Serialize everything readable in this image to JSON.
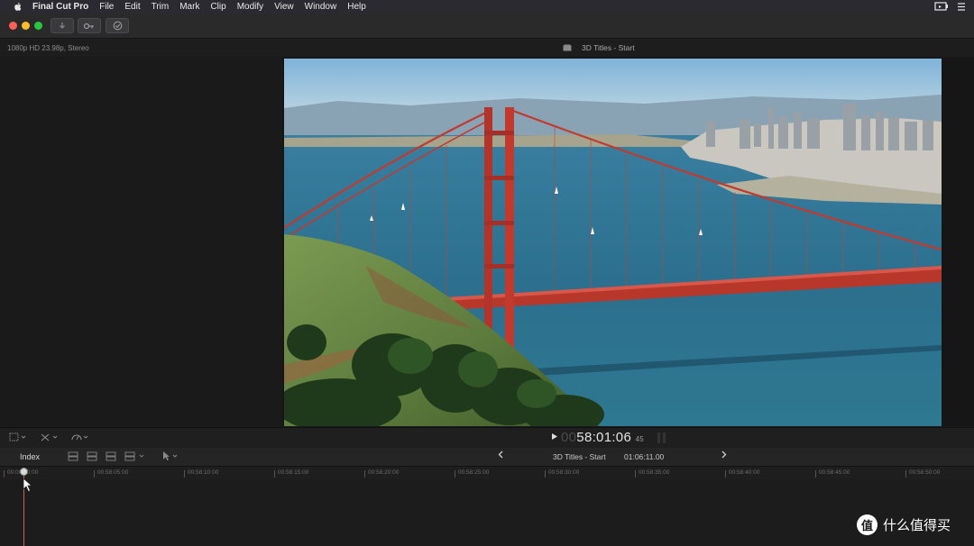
{
  "menubar": {
    "app_name": "Final Cut Pro",
    "items": [
      "File",
      "Edit",
      "Trim",
      "Mark",
      "Clip",
      "Modify",
      "View",
      "Window",
      "Help"
    ]
  },
  "toolbar": {
    "buttons": [
      "import-icon",
      "keyword-icon",
      "background-tasks-icon"
    ]
  },
  "viewer": {
    "format": "1080p HD 23.98p, Stereo",
    "project_title": "3D Titles - Start"
  },
  "transport": {
    "timecode_dim": "00",
    "timecode": "58:01:06",
    "timecode_frames": "45"
  },
  "timeline": {
    "index_label": "Index",
    "project_name": "3D Titles - Start",
    "duration": "01:06:11.00",
    "ruler": [
      "00:00:00:00",
      "00:58:05:00",
      "00:58:10:00",
      "00:58:15:00",
      "00:58:20:00",
      "00:58:25:00",
      "00:58:30:00",
      "00:58:35:00",
      "00:58:40:00",
      "00:58:45:00",
      "00:58:50:00"
    ]
  },
  "watermark": {
    "logo_char": "值",
    "text": "什么值得买"
  },
  "colors": {
    "accent_playhead": "#c46a4e",
    "bridge_red": "#c23a2e",
    "water": "#2b6f8e"
  }
}
